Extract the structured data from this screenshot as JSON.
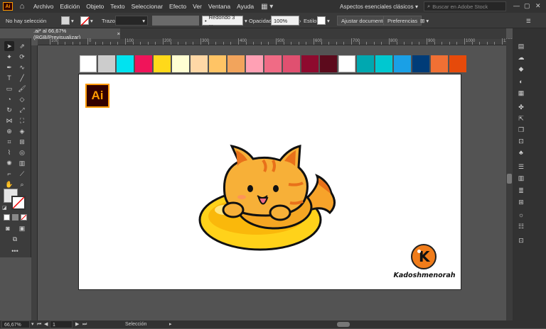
{
  "menubar": {
    "logo": "Ai",
    "items": [
      "Archivo",
      "Edición",
      "Objeto",
      "Texto",
      "Seleccionar",
      "Efecto",
      "Ver",
      "Ventana",
      "Ayuda"
    ],
    "workspace": "Aspectos esenciales clásicos",
    "stock_placeholder": "Buscar en Adobe Stock"
  },
  "controlbar": {
    "selection": "No hay selección",
    "stroke_label": "Trazo:",
    "brush": "Redondo 3 ...",
    "opacity_label": "Opacidad:",
    "opacity_value": "100%",
    "style_label": "Estilo:",
    "document_button": "Ajustar documento",
    "prefs_button": "Preferencias"
  },
  "document": {
    "tab_title": ".ai* al 66,67% (RGB/Previsualizar)",
    "tab_close": "×",
    "ruler_marks": [
      "100",
      "0",
      "100",
      "200",
      "300",
      "400",
      "500",
      "600",
      "700",
      "800",
      "900",
      "1000",
      "1100"
    ]
  },
  "artboard": {
    "badge": "Ai",
    "logo_letter": "K",
    "signature": "Kadoshmenorah",
    "swatch_colors": [
      "#ffffff",
      "#cccccc",
      "#00e3f0",
      "#f0145a",
      "#ffd91a",
      "#fffed2",
      "#ffd8a6",
      "#ffc465",
      "#f2a45c",
      "#ffa0b4",
      "#f06b85",
      "#e05070",
      "#8e0a2e",
      "#5c0a1c",
      "#ffffff",
      "#00a8b0",
      "#00c8d0",
      "#1aa0e6",
      "#003c78",
      "#f07034",
      "#e64a0a"
    ]
  },
  "statusbar": {
    "zoom": "66,67%",
    "artboard_num": "1",
    "tool": "Selección"
  },
  "colors": {
    "accent": "#ff9a00",
    "cat_orange": "#f5a623",
    "cat_stripe": "#e8711a",
    "float_yellow": "#ffd21a"
  }
}
